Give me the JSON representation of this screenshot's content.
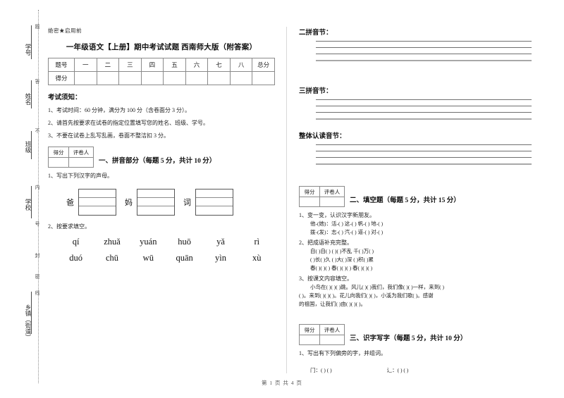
{
  "document": {
    "secret_mark": "绝密★启用前",
    "title": "一年级语文【上册】期中考试试题 西南师大版（附答案）",
    "footer": "第 1 页 共 4 页"
  },
  "seal_margin": {
    "labels": [
      {
        "main": "学号",
        "sub": "题"
      },
      {
        "main": "姓名",
        "sub": "答"
      },
      {
        "main": "班级",
        "sub": "不"
      },
      {
        "main": "学校",
        "sub": "内"
      },
      {
        "main": "乡镇（街道）",
        "sub": "线"
      }
    ],
    "extra_subs": [
      "号",
      "封",
      "密"
    ]
  },
  "score_table": {
    "row_labels": [
      "题号",
      "得分"
    ],
    "columns": [
      "一",
      "二",
      "三",
      "四",
      "五",
      "六",
      "七",
      "八",
      "总分"
    ],
    "scores": [
      "",
      "",
      "",
      "",
      "",
      "",
      "",
      "",
      ""
    ]
  },
  "notice": {
    "title": "考试须知：",
    "items": [
      "1、考试时间：60 分钟，满分为 100 分（含卷面分 3 分）。",
      "2、请首先按要求在试卷的指定位置填写您的姓名、班级、学号。",
      "3、不要在试卷上乱写乱画，卷面不整洁扣 3 分。"
    ]
  },
  "grader_box": {
    "score_label": "得分",
    "grader_label": "评卷人"
  },
  "section1": {
    "heading": "一、拼音部分（每题 5 分，共计 10 分）",
    "q1": "1、写出下列汉字的声母。",
    "tianzige": [
      {
        "char": "爸"
      },
      {
        "char": "妈"
      },
      {
        "char": "词"
      }
    ],
    "q2": "2、按要求填空。",
    "pinyin_row1": [
      "qí",
      "zhuǎ",
      "yuán",
      "huō",
      "yǎ",
      "rì"
    ],
    "pinyin_row2": [
      "duó",
      "chū",
      "wū",
      "quān",
      "yìn",
      "xù"
    ],
    "answer_groups": [
      {
        "label": "二拼音节：",
        "lines": 4
      },
      {
        "label": "三拼音节：",
        "lines": 4
      },
      {
        "label": "整体认读音节：",
        "lines": 4
      }
    ]
  },
  "section2": {
    "heading": "二、填空题（每题 5 分，共计 15 分）",
    "q1": "1、变一变，认识汉字新朋友。",
    "q1_lines": [
      "他-(她)：活-(  )  这-(  )  帆-(  )  地-(  )",
      "拨-(发)：志-(  )  汽-(  )  道-(  )  对-(  )"
    ],
    "q2": "2、把成语补充完整。",
    "q2_lines": [
      "自(  )自(  )      (  )(  )不乱      千(  )万(  )",
      "(  )长(  )久      (  )大(  )深      (  )积(  )累",
      "春(  )(  )(  )    春(  )(  )(  )    春(  )(  )(  )"
    ],
    "q3": "3、按课文内容填空。",
    "q3_lines": [
      "小鸟在(  )(  )(  )跳。风儿(  )(  )我们，我们像(  )(  )一样，来到(  )",
      "(  )。来到(  )(  )(  )。花儿向我们(  )(  )，小溪为我们歌(  )。感谢",
      "的祖国，让我们(  )由(  )(  )(  )。"
    ]
  },
  "section3": {
    "heading": "三、识字写字（每题 5 分，共计 10 分）",
    "q1": "1、写出有下列偏旁的字，并组词。",
    "q1_lines": [
      "门：(      ) (        )",
      "辶：(      ) (        )"
    ]
  }
}
